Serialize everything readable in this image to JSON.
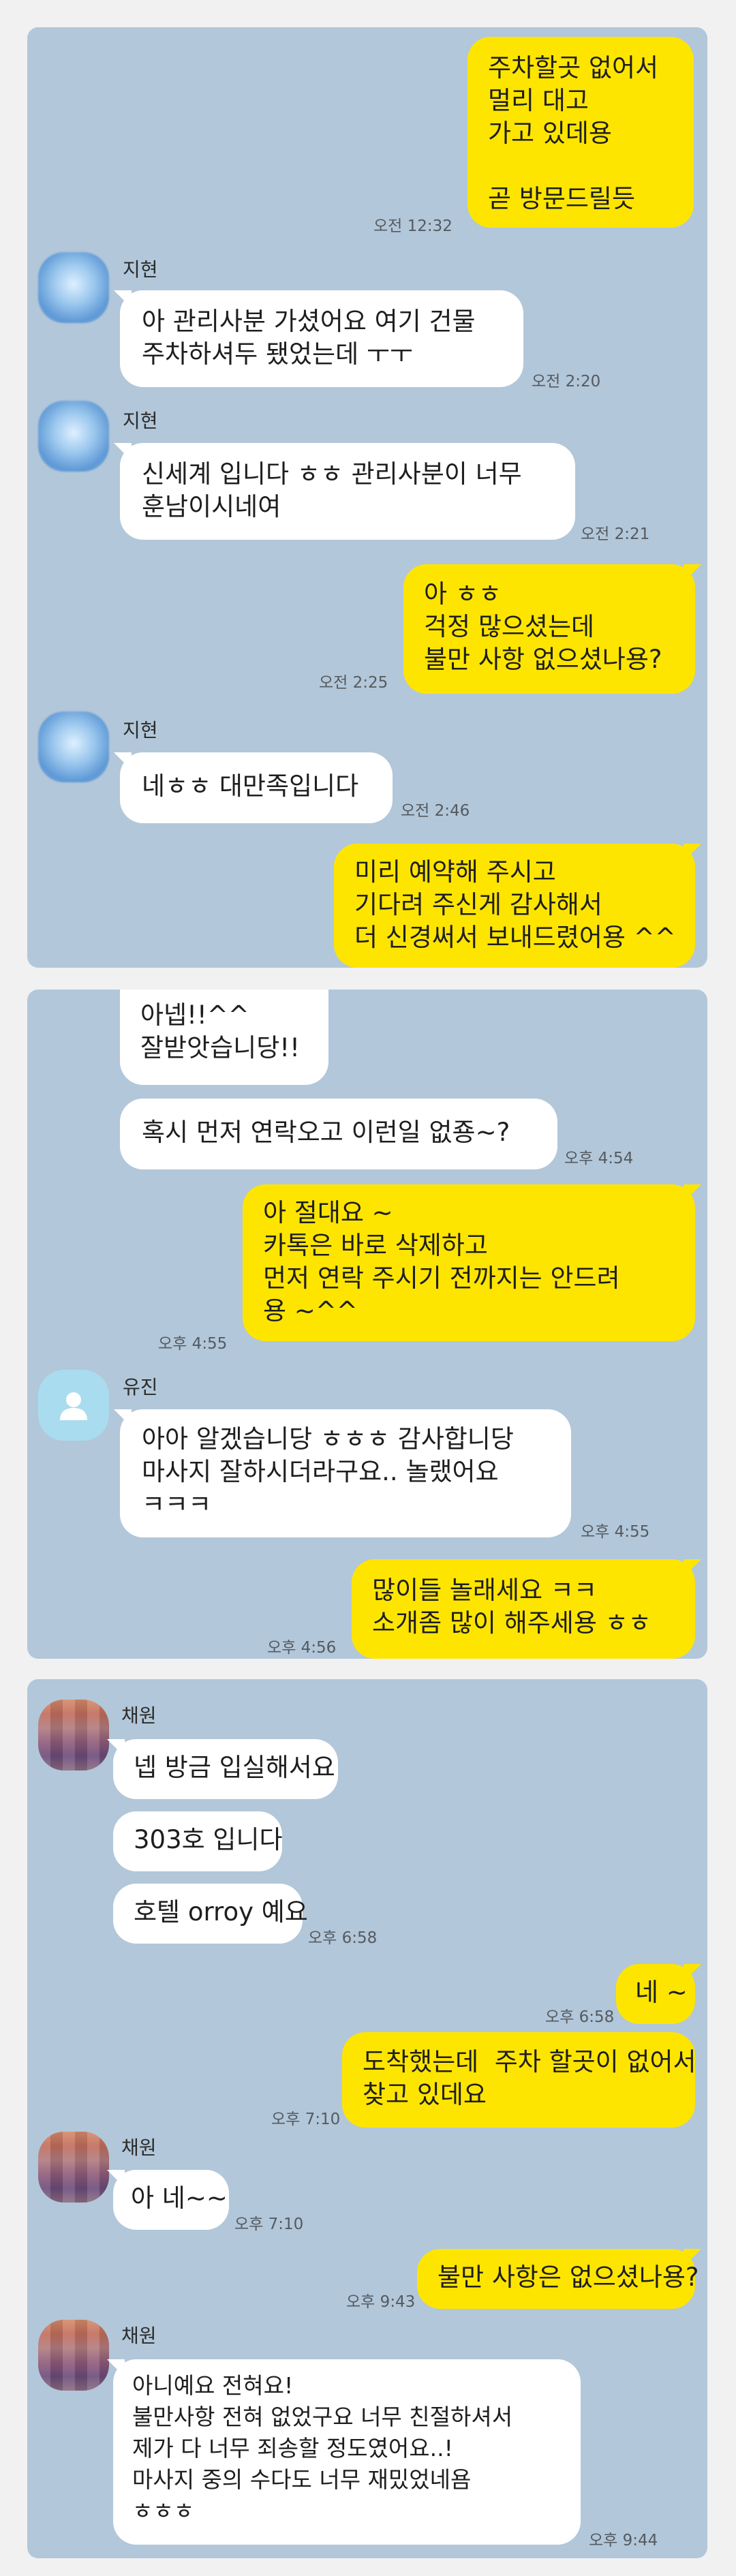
{
  "panel1": {
    "m1": {
      "text": "주차할곳 없어서\n멀리 대고\n가고 있데용\n\n곧 방문드릴듯",
      "time": "오전 12:32"
    },
    "sender": "지현",
    "m2": {
      "text": "아 관리사분 가셨어요 여기 건물\n주차하셔두 됐었는데 ㅜㅜ",
      "time": "오전 2:20"
    },
    "m3": {
      "text": "신세계 입니다 ㅎㅎ 관리사분이 너무\n훈남이시네여",
      "time": "오전 2:21"
    },
    "m4": {
      "text": "아 ㅎㅎ\n걱정 많으셨는데\n불만 사항 없으셨나용?",
      "time": "오전 2:25"
    },
    "m5": {
      "text": "네ㅎㅎ 대만족입니다",
      "time": "오전 2:46"
    },
    "m6": {
      "text": "미리 예약해 주시고\n기다려 주신게 감사해서\n더 신경써서 보내드렸어용 ^^"
    }
  },
  "panel2": {
    "m1": {
      "text": "아넵!!^^\n잘받앗습니당!!"
    },
    "m2": {
      "text": "혹시 먼저 연락오고 이런일 없죵~?",
      "time": "오후 4:54"
    },
    "m3": {
      "text": "아 절대요 ~\n카톡은 바로 삭제하고\n먼저 연락 주시기 전까지는 안드려\n용 ~^^",
      "time": "오후 4:55"
    },
    "sender": "유진",
    "m4": {
      "text": "아아 알겠습니당 ㅎㅎㅎ 감사합니당\n마사지 잘하시더라구요.. 놀랬어요\nㅋㅋㅋ",
      "time": "오후 4:55"
    },
    "m5": {
      "text": "많이들 놀래세요 ㅋㅋ\n소개좀 많이 해주세용 ㅎㅎ",
      "time": "오후 4:56"
    }
  },
  "panel3": {
    "sender": "채원",
    "m1": {
      "text": "넵 방금 입실해서요"
    },
    "m2": {
      "text": "303호 입니다"
    },
    "m3": {
      "text": "호텔 orroy 예요",
      "time": "오후 6:58"
    },
    "m4": {
      "text": "네 ~",
      "time": "오후 6:58"
    },
    "m5": {
      "text": "도착했는데  주차 할곳이 없어서\n찾고 있데요",
      "time": "오후 7:10"
    },
    "m6": {
      "text": "아 네~~",
      "time": "오후 7:10"
    },
    "m7": {
      "text": "불만 사항은 없으셨나용?",
      "time": "오후 9:43"
    },
    "m8": {
      "text": "아니예요 전혀요!\n불만사항 전혀 없었구요 너무 친절하셔서\n제가 다 너무 죄송할 정도였어요..!\n마사지 중의 수다도 너무 재밌었네욤\nㅎㅎㅎ",
      "time": "오후 9:44"
    }
  },
  "icons": [
    "blurred-avatar",
    "default-person-avatar",
    "pixelated-avatar"
  ],
  "colors": {
    "chat_bg": "#b2c7d9",
    "my_bubble": "#fee500",
    "their_bubble": "#ffffff",
    "page_bg": "#f1f1f2"
  }
}
